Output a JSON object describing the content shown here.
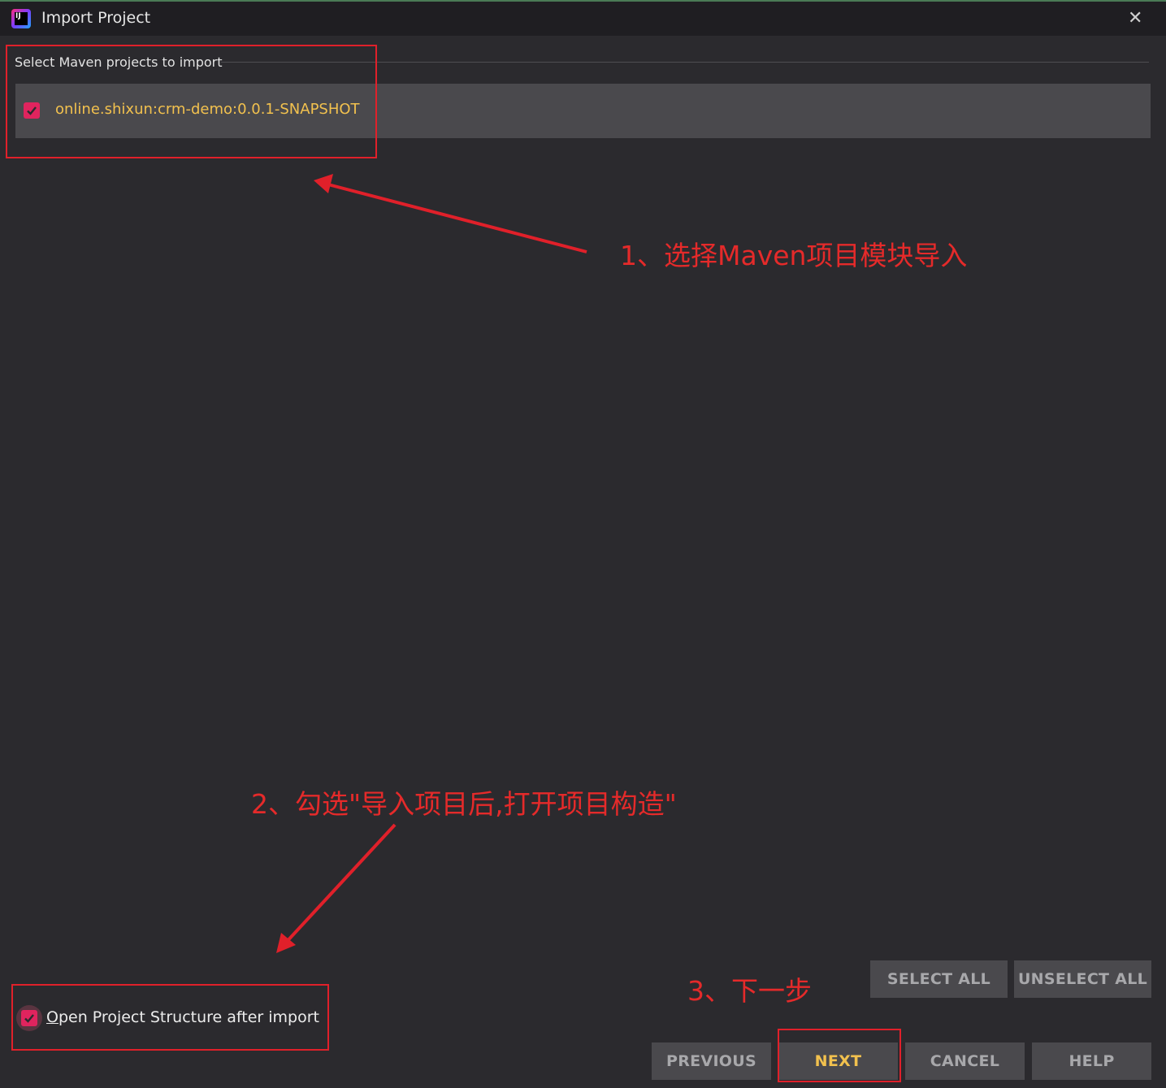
{
  "window": {
    "title": "Import Project",
    "close_glyph": "✕"
  },
  "app_icon_text": "IJ",
  "section": {
    "label": "Select Maven projects to import"
  },
  "projects": [
    {
      "label": "online.shixun:crm-demo:0.0.1-SNAPSHOT",
      "checked": true
    }
  ],
  "options": {
    "open_structure": {
      "mnemonic": "O",
      "rest": "pen Project Structure after import",
      "checked": true
    }
  },
  "buttons": {
    "select_all": "SELECT ALL",
    "unselect_all": "UNSELECT ALL",
    "previous": "PREVIOUS",
    "next": "NEXT",
    "cancel": "CANCEL",
    "help": "HELP"
  },
  "annotations": {
    "step1": "1、选择Maven项目模块导入",
    "step2": "2、勾选\"导入项目后,打开项目构造\"",
    "step3": "3、下一步"
  },
  "colors": {
    "background": "#2b2a2e",
    "accent": "#e0245e",
    "annotation": "#e52a2a",
    "highlight_text": "#f2c14e"
  }
}
